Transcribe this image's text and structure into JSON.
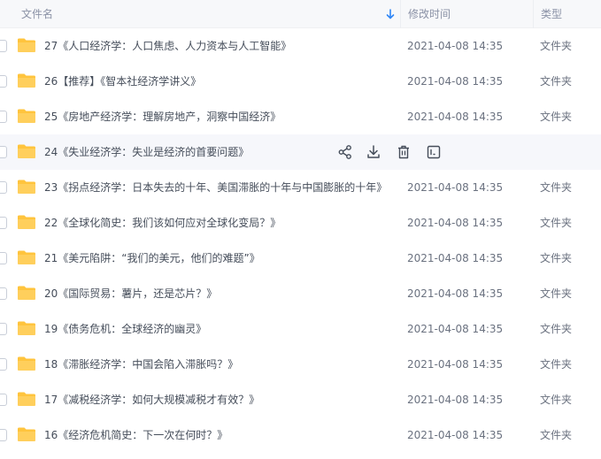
{
  "header": {
    "name_label": "文件名",
    "time_label": "修改时间",
    "type_label": "类型",
    "sort_icon": "sort-down-arrow-icon"
  },
  "colors": {
    "folder": "#ffc43d",
    "sort_arrow": "#2f86f6",
    "hover_row": "#f6f7fb"
  },
  "rows": [
    {
      "name": "27《人口经济学：人口焦虑、人力资本与人工智能》",
      "time": "2021-04-08 14:35",
      "type": "文件夹"
    },
    {
      "name": "26【推荐】《智本社经济学讲义》",
      "time": "2021-04-08 14:35",
      "type": "文件夹"
    },
    {
      "name": "25《房地产经济学：理解房地产，洞察中国经济》",
      "time": "2021-04-08 14:35",
      "type": "文件夹"
    },
    {
      "name": "24《失业经济学：失业是经济的首要问题》",
      "time": "",
      "type": "",
      "hovered": true
    },
    {
      "name": "23《拐点经济学：日本失去的十年、美国滞胀的十年与中国膨胀的十年》",
      "time": "2021-04-08 14:35",
      "type": "文件夹"
    },
    {
      "name": "22《全球化简史：我们该如何应对全球化变局？》",
      "time": "2021-04-08 14:35",
      "type": "文件夹"
    },
    {
      "name": "21《美元陷阱：“我们的美元，他们的难题”》",
      "time": "2021-04-08 14:35",
      "type": "文件夹"
    },
    {
      "name": "20《国际贸易：薯片，还是芯片？》",
      "time": "2021-04-08 14:35",
      "type": "文件夹"
    },
    {
      "name": "19《债务危机：全球经济的幽灵》",
      "time": "2021-04-08 14:35",
      "type": "文件夹"
    },
    {
      "name": "18《滞胀经济学：中国会陷入滞胀吗？》",
      "time": "2021-04-08 14:35",
      "type": "文件夹"
    },
    {
      "name": "17《减税经济学：如何大规模减税才有效？》",
      "time": "2021-04-08 14:35",
      "type": "文件夹"
    },
    {
      "name": "16《经济危机简史：下一次在何时？》",
      "time": "2021-04-08 14:35",
      "type": "文件夹"
    }
  ],
  "row_actions": [
    "share-icon",
    "download-icon",
    "delete-icon",
    "more-icon"
  ]
}
